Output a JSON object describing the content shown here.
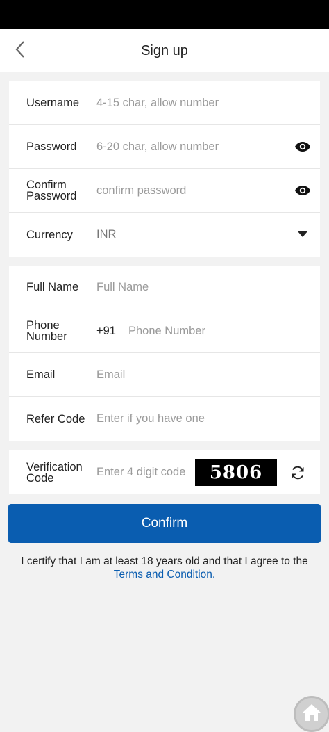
{
  "header": {
    "title": "Sign up",
    "back_icon": "chevron-left-icon"
  },
  "account": {
    "username": {
      "label": "Username",
      "placeholder": "4-15 char, allow number"
    },
    "password": {
      "label": "Password",
      "placeholder": "6-20 char, allow number",
      "icon": "eye-icon"
    },
    "confirm_password": {
      "label_line1": "Confirm",
      "label_line2": "Password",
      "placeholder": "confirm password",
      "icon": "eye-icon"
    },
    "currency": {
      "label": "Currency",
      "value": "INR",
      "icon": "caret-down-icon"
    }
  },
  "profile": {
    "full_name": {
      "label": "Full Name",
      "placeholder": "Full Name"
    },
    "phone": {
      "label_line1": "Phone",
      "label_line2": "Number",
      "prefix": "+91",
      "placeholder": "Phone Number"
    },
    "email": {
      "label": "Email",
      "placeholder": "Email"
    },
    "refer_code": {
      "label": "Refer Code",
      "placeholder": "Enter if you have one"
    }
  },
  "verification": {
    "label_line1": "Verification",
    "label_line2": "Code",
    "placeholder": "Enter 4 digit code",
    "captcha": "5806",
    "icon": "refresh-icon"
  },
  "confirm_label": "Confirm",
  "certify": {
    "text": "I certify that I am at least 18 years old and that I agree to the",
    "link": "Terms and Condition."
  },
  "colors": {
    "primary": "#0a5db0",
    "background": "#f2f2f2",
    "status_bar": "#000000"
  },
  "floating": {
    "icon": "home-icon"
  }
}
